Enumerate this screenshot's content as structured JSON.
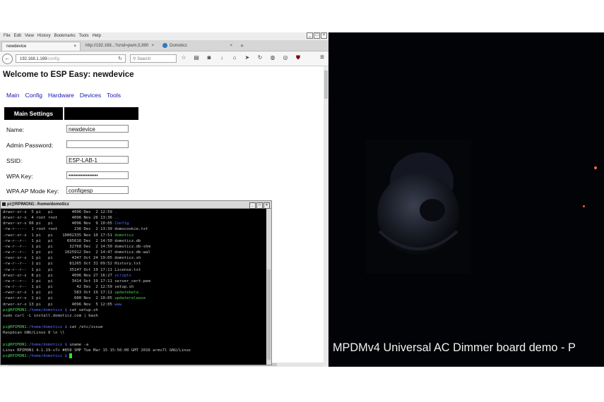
{
  "browser": {
    "menu": [
      "File",
      "Edit",
      "View",
      "History",
      "Bookmarks",
      "Tools",
      "Help"
    ],
    "tabs": [
      {
        "label": "newdevice",
        "active": true
      },
      {
        "label": "http://192.168...?cmd=pwm,5,990",
        "active": false
      },
      {
        "label": "Domoticz",
        "active": false
      }
    ],
    "newtab": "+",
    "url_host": "192.168.1.169",
    "url_path": "/config",
    "search_placeholder": "Search"
  },
  "page": {
    "title": "Welcome to ESP Easy: newdevice",
    "nav": [
      "Main",
      "Config",
      "Hardware",
      "Devices",
      "Tools"
    ],
    "section_header": "Main Settings",
    "fields": [
      {
        "label": "Name:",
        "value": "newdevice"
      },
      {
        "label": "Admin Password:",
        "value": ""
      },
      {
        "label": "SSID:",
        "value": "ESP-LAB-1"
      },
      {
        "label": "WPA Key:",
        "value": "•••••••••••••••••"
      },
      {
        "label": "WPA AP Mode Key:",
        "value": "configesp"
      }
    ]
  },
  "terminal": {
    "title": "pi@RPIMON1: /home/domoticz",
    "listing": [
      {
        "perm": "drwxr-xr-x",
        "links": "5",
        "user": "pi",
        "group": "pi",
        "size": "4096",
        "date": "Dec  2 12:59",
        "name": ".",
        "kind": "dir"
      },
      {
        "perm": "drwxr-xr-x",
        "links": "4",
        "user": "root",
        "group": "root",
        "size": "4096",
        "date": "Nov 26 13:36",
        "name": "..",
        "kind": "dir"
      },
      {
        "perm": "drwxr-xr-x",
        "links": "66",
        "user": "pi",
        "group": "pi",
        "size": "4096",
        "date": "Nov  9 10:05",
        "name": "Config",
        "kind": "dir"
      },
      {
        "perm": "-rw-r-----",
        "links": "1",
        "user": "root",
        "group": "root",
        "size": "236",
        "date": "Dec  2 13:39",
        "name": "domocookie.txt",
        "kind": "file"
      },
      {
        "perm": "-rwxr-xr-x",
        "links": "1",
        "user": "pi",
        "group": "pi",
        "size": "10002335",
        "date": "Nov 10 17:51",
        "name": "domoticz",
        "kind": "exe"
      },
      {
        "perm": "-rw-r--r--",
        "links": "1",
        "user": "pi",
        "group": "pi",
        "size": "695616",
        "date": "Dec  2 14:50",
        "name": "domoticz.db",
        "kind": "file"
      },
      {
        "perm": "-rw-r--r--",
        "links": "1",
        "user": "pi",
        "group": "pi",
        "size": "32768",
        "date": "Dec  2 14:50",
        "name": "domoticz.db-shm",
        "kind": "file"
      },
      {
        "perm": "-rw-r--r--",
        "links": "1",
        "user": "pi",
        "group": "pi",
        "size": "1025912",
        "date": "Dec  2 14:47",
        "name": "domoticz.db-wal",
        "kind": "file"
      },
      {
        "perm": "-rwxr-xr-x",
        "links": "1",
        "user": "pi",
        "group": "pi",
        "size": "4347",
        "date": "Oct 24 19:05",
        "name": "domoticz.sh",
        "kind": "file"
      },
      {
        "perm": "-rw-r--r--",
        "links": "1",
        "user": "pi",
        "group": "pi",
        "size": "81265",
        "date": "Oct 31 09:52",
        "name": "History.txt",
        "kind": "file"
      },
      {
        "perm": "-rw-r--r--",
        "links": "1",
        "user": "pi",
        "group": "pi",
        "size": "35147",
        "date": "Oct 19 17:11",
        "name": "License.txt",
        "kind": "file"
      },
      {
        "perm": "drwxr-xr-x",
        "links": "8",
        "user": "pi",
        "group": "pi",
        "size": "4096",
        "date": "Nov 27 16:27",
        "name": "scripts",
        "kind": "dir"
      },
      {
        "perm": "-rw-r--r--",
        "links": "1",
        "user": "pi",
        "group": "pi",
        "size": "3414",
        "date": "Oct 19 17:11",
        "name": "server_cert.pem",
        "kind": "file"
      },
      {
        "perm": "-rw-r--r--",
        "links": "1",
        "user": "pi",
        "group": "pi",
        "size": "42",
        "date": "Dec  2 12:59",
        "name": "setup.sh",
        "kind": "file"
      },
      {
        "perm": "-rwxr-xr-x",
        "links": "1",
        "user": "pi",
        "group": "pi",
        "size": "583",
        "date": "Oct 19 17:11",
        "name": "updatebeta",
        "kind": "exe"
      },
      {
        "perm": "-rwxr-xr-x",
        "links": "1",
        "user": "pi",
        "group": "pi",
        "size": "600",
        "date": "Nov  2 10:05",
        "name": "updaterelease",
        "kind": "exe"
      },
      {
        "perm": "drwxr-xr-x",
        "links": "13",
        "user": "pi",
        "group": "pi",
        "size": "4096",
        "date": "Nov  5 12:05",
        "name": "www",
        "kind": "dir"
      }
    ],
    "session": [
      {
        "type": "prompt",
        "user": "pi@RPIMON1",
        "path": ":/home/domoticz $",
        "cmd": " cat setup.sh"
      },
      {
        "type": "out",
        "text": "sudo curl -L install.domoticz.com | bash"
      },
      {
        "type": "blank"
      },
      {
        "type": "prompt",
        "user": "pi@RPIMON1",
        "path": ":/home/domoticz $",
        "cmd": " cat /etc/issue"
      },
      {
        "type": "out",
        "text": "Raspbian GNU/Linux 8 \\n \\l"
      },
      {
        "type": "blank"
      },
      {
        "type": "prompt",
        "user": "pi@RPIMON1",
        "path": ":/home/domoticz $",
        "cmd": " uname -a"
      },
      {
        "type": "out",
        "text": "Linux RPIMON1 4.1.19-v7+ #858 SMP Tue Mar 15 15:56:00 GMT 2016 armv7l GNU/Linux"
      },
      {
        "type": "cursor",
        "user": "pi@RPIMON1",
        "path": ":/home/domoticz $",
        "cmd": " "
      }
    ]
  },
  "video": {
    "caption": "MPDMv4 Universal AC Dimmer board demo - P"
  },
  "colors": {
    "terminal_bg": "#000000",
    "prompt_green": "#4bd85a",
    "dir_blue": "#5a73ff",
    "link_blue": "#1414b8",
    "header_black": "#000000"
  }
}
